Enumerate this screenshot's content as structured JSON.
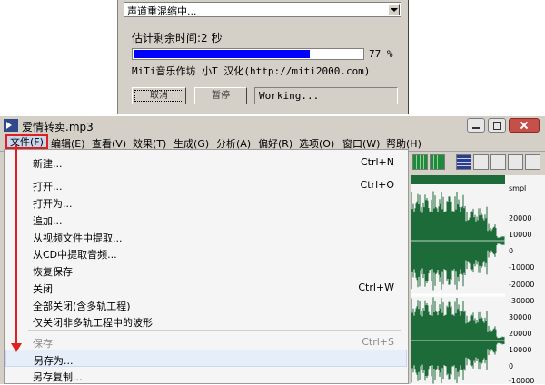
{
  "progress_dialog": {
    "operation": "声道重混缩中...",
    "time_left": "估计剩余时间:2 秒",
    "progress_pct": 77,
    "progress_text": "77 %",
    "credit": "MiTi音乐作坊 小T 汉化(http://miti2000.com)",
    "cancel_label": "取消",
    "pause_label": "暂停",
    "status": "Working..."
  },
  "window": {
    "title": "爱情转卖.mp3"
  },
  "menubar": {
    "items": [
      "文件(F)",
      "编辑(E)",
      "查看(V)",
      "效果(T)",
      "生成(G)",
      "分析(A)",
      "偏好(R)",
      "选项(O)",
      "窗口(W)",
      "帮助(H)"
    ]
  },
  "file_menu": {
    "items": [
      {
        "label": "新建...",
        "shortcut": "Ctrl+N"
      },
      {
        "label": "打开...",
        "shortcut": "Ctrl+O"
      },
      {
        "label": "打开为...",
        "shortcut": ""
      },
      {
        "label": "追加...",
        "shortcut": ""
      },
      {
        "label": "从视频文件中提取...",
        "shortcut": ""
      },
      {
        "label": "从CD中提取音频...",
        "shortcut": ""
      },
      {
        "label": "恢复保存",
        "shortcut": ""
      },
      {
        "label": "关闭",
        "shortcut": "Ctrl+W"
      },
      {
        "label": "全部关闭(含多轨工程)",
        "shortcut": ""
      },
      {
        "label": "仅关闭非多轨工程中的波形",
        "shortcut": ""
      },
      {
        "label": "保存",
        "shortcut": "Ctrl+S",
        "disabled": true
      },
      {
        "label": "另存为...",
        "shortcut": "",
        "highlighted": true
      },
      {
        "label": "另存复制...",
        "shortcut": ""
      }
    ]
  },
  "waveform": {
    "ruler_unit": "smpl",
    "ruler_labels": [
      "20000",
      "10000",
      "0",
      "-10000",
      "-20000",
      "-30000",
      "30000",
      "20000",
      "10000",
      "0",
      "-10000"
    ]
  },
  "colors": {
    "accent": "#e02020",
    "progress": "#0000ff",
    "wave": "#1e6b3a"
  }
}
